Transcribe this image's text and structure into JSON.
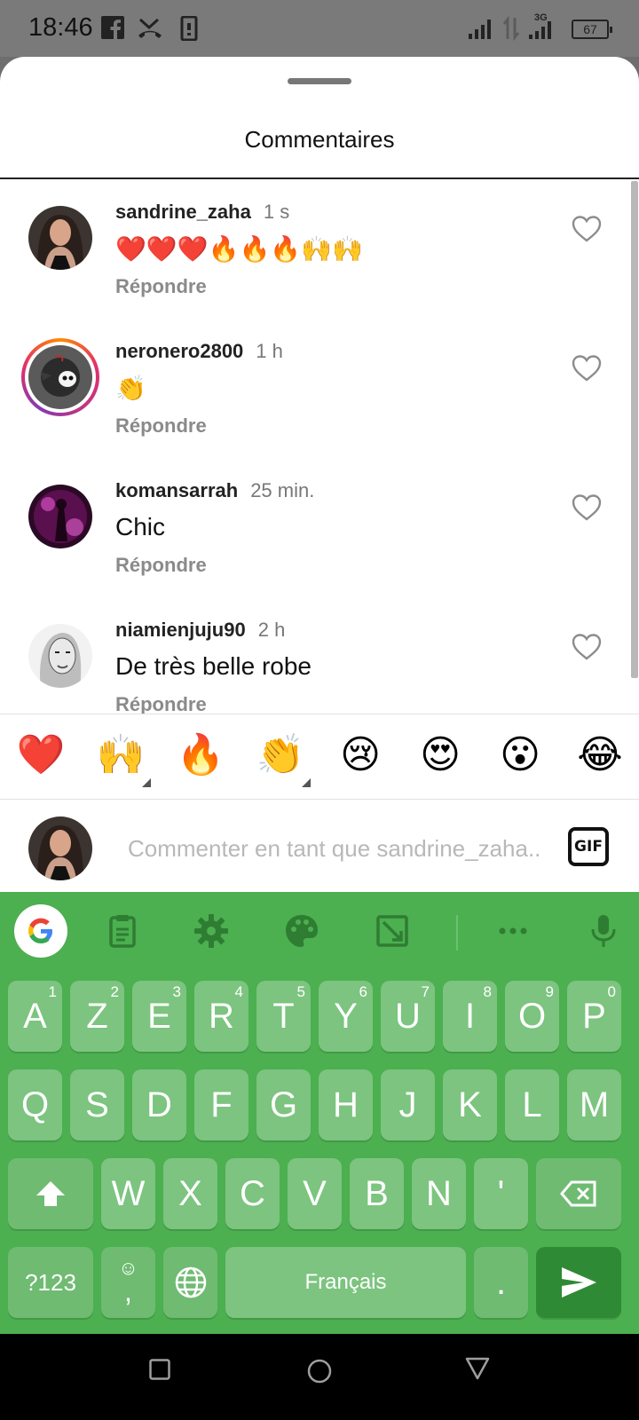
{
  "status_bar": {
    "time": "18:46",
    "battery": "67",
    "network": "3G"
  },
  "sheet": {
    "title": "Commentaires"
  },
  "comments": [
    {
      "username": "sandrine_zaha",
      "time": "1 s",
      "text": "❤️❤️❤️🔥🔥🔥🙌🙌",
      "reply": "Répondre"
    },
    {
      "username": "neronero2800",
      "time": "1 h",
      "text": "👏",
      "reply": "Répondre"
    },
    {
      "username": "komansarrah",
      "time": "25 min.",
      "text": "Chic",
      "reply": "Répondre"
    },
    {
      "username": "niamienjuju90",
      "time": "2 h",
      "text": "De très belle robe",
      "reply": "Répondre"
    }
  ],
  "emoji_bar": [
    "❤️",
    "🙌",
    "🔥",
    "👏",
    "😢",
    "😍",
    "😮",
    "😂"
  ],
  "input": {
    "placeholder": "Commenter en tant que sandrine_zaha...",
    "gif_label": "GIF"
  },
  "keyboard": {
    "row1": [
      {
        "key": "A",
        "hint": "1"
      },
      {
        "key": "Z",
        "hint": "2"
      },
      {
        "key": "E",
        "hint": "3"
      },
      {
        "key": "R",
        "hint": "4"
      },
      {
        "key": "T",
        "hint": "5"
      },
      {
        "key": "Y",
        "hint": "6"
      },
      {
        "key": "U",
        "hint": "7"
      },
      {
        "key": "I",
        "hint": "8"
      },
      {
        "key": "O",
        "hint": "9"
      },
      {
        "key": "P",
        "hint": "0"
      }
    ],
    "row2": [
      "Q",
      "S",
      "D",
      "F",
      "G",
      "H",
      "J",
      "K",
      "L",
      "M"
    ],
    "row3": [
      "W",
      "X",
      "C",
      "V",
      "B",
      "N",
      "'"
    ],
    "symbols_label": "?123",
    "comma_label": ",",
    "space_label": "Français",
    "period_label": "."
  },
  "colors": {
    "keyboard_bg": "#4caf50",
    "key": "#7cc47f",
    "enter_key": "#2f8a35"
  }
}
